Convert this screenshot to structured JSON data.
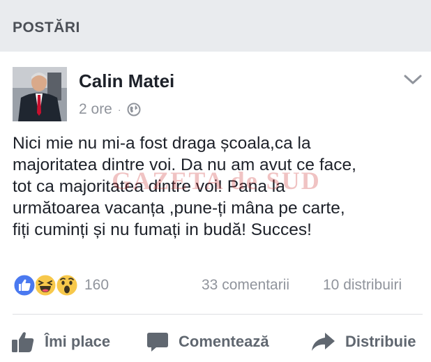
{
  "section": {
    "title": "POSTĂRI"
  },
  "post": {
    "author": "Calin Matei",
    "time": "2 ore",
    "separator": "·",
    "privacy_icon": "globe-icon",
    "text_lines": [
      "Nici mie nu mi-a fost draga școala,ca la",
      "majoritatea dintre voi. Da nu am avut ce face,",
      "tot ca majoritatea dintre voi! Pana la",
      "următoarea vacanța ,pune-ți mâna pe carte,",
      "fiți cuminți și nu fumați in budă! Succes!"
    ],
    "watermark": "GAZETA de SUD"
  },
  "stats": {
    "reactions": [
      "like",
      "haha",
      "wow"
    ],
    "reaction_count": "160",
    "comments": "33 comentarii",
    "shares": "10 distribuiri"
  },
  "actions": {
    "like_label": "Îmi place",
    "comment_label": "Comentează",
    "share_label": "Distribuie"
  },
  "colors": {
    "header_bg": "#e9ebee",
    "like_blue": "#4a79f0",
    "emoji_yellow": "#f7c84b",
    "muted_text": "#90949c",
    "action_text": "#606770"
  }
}
